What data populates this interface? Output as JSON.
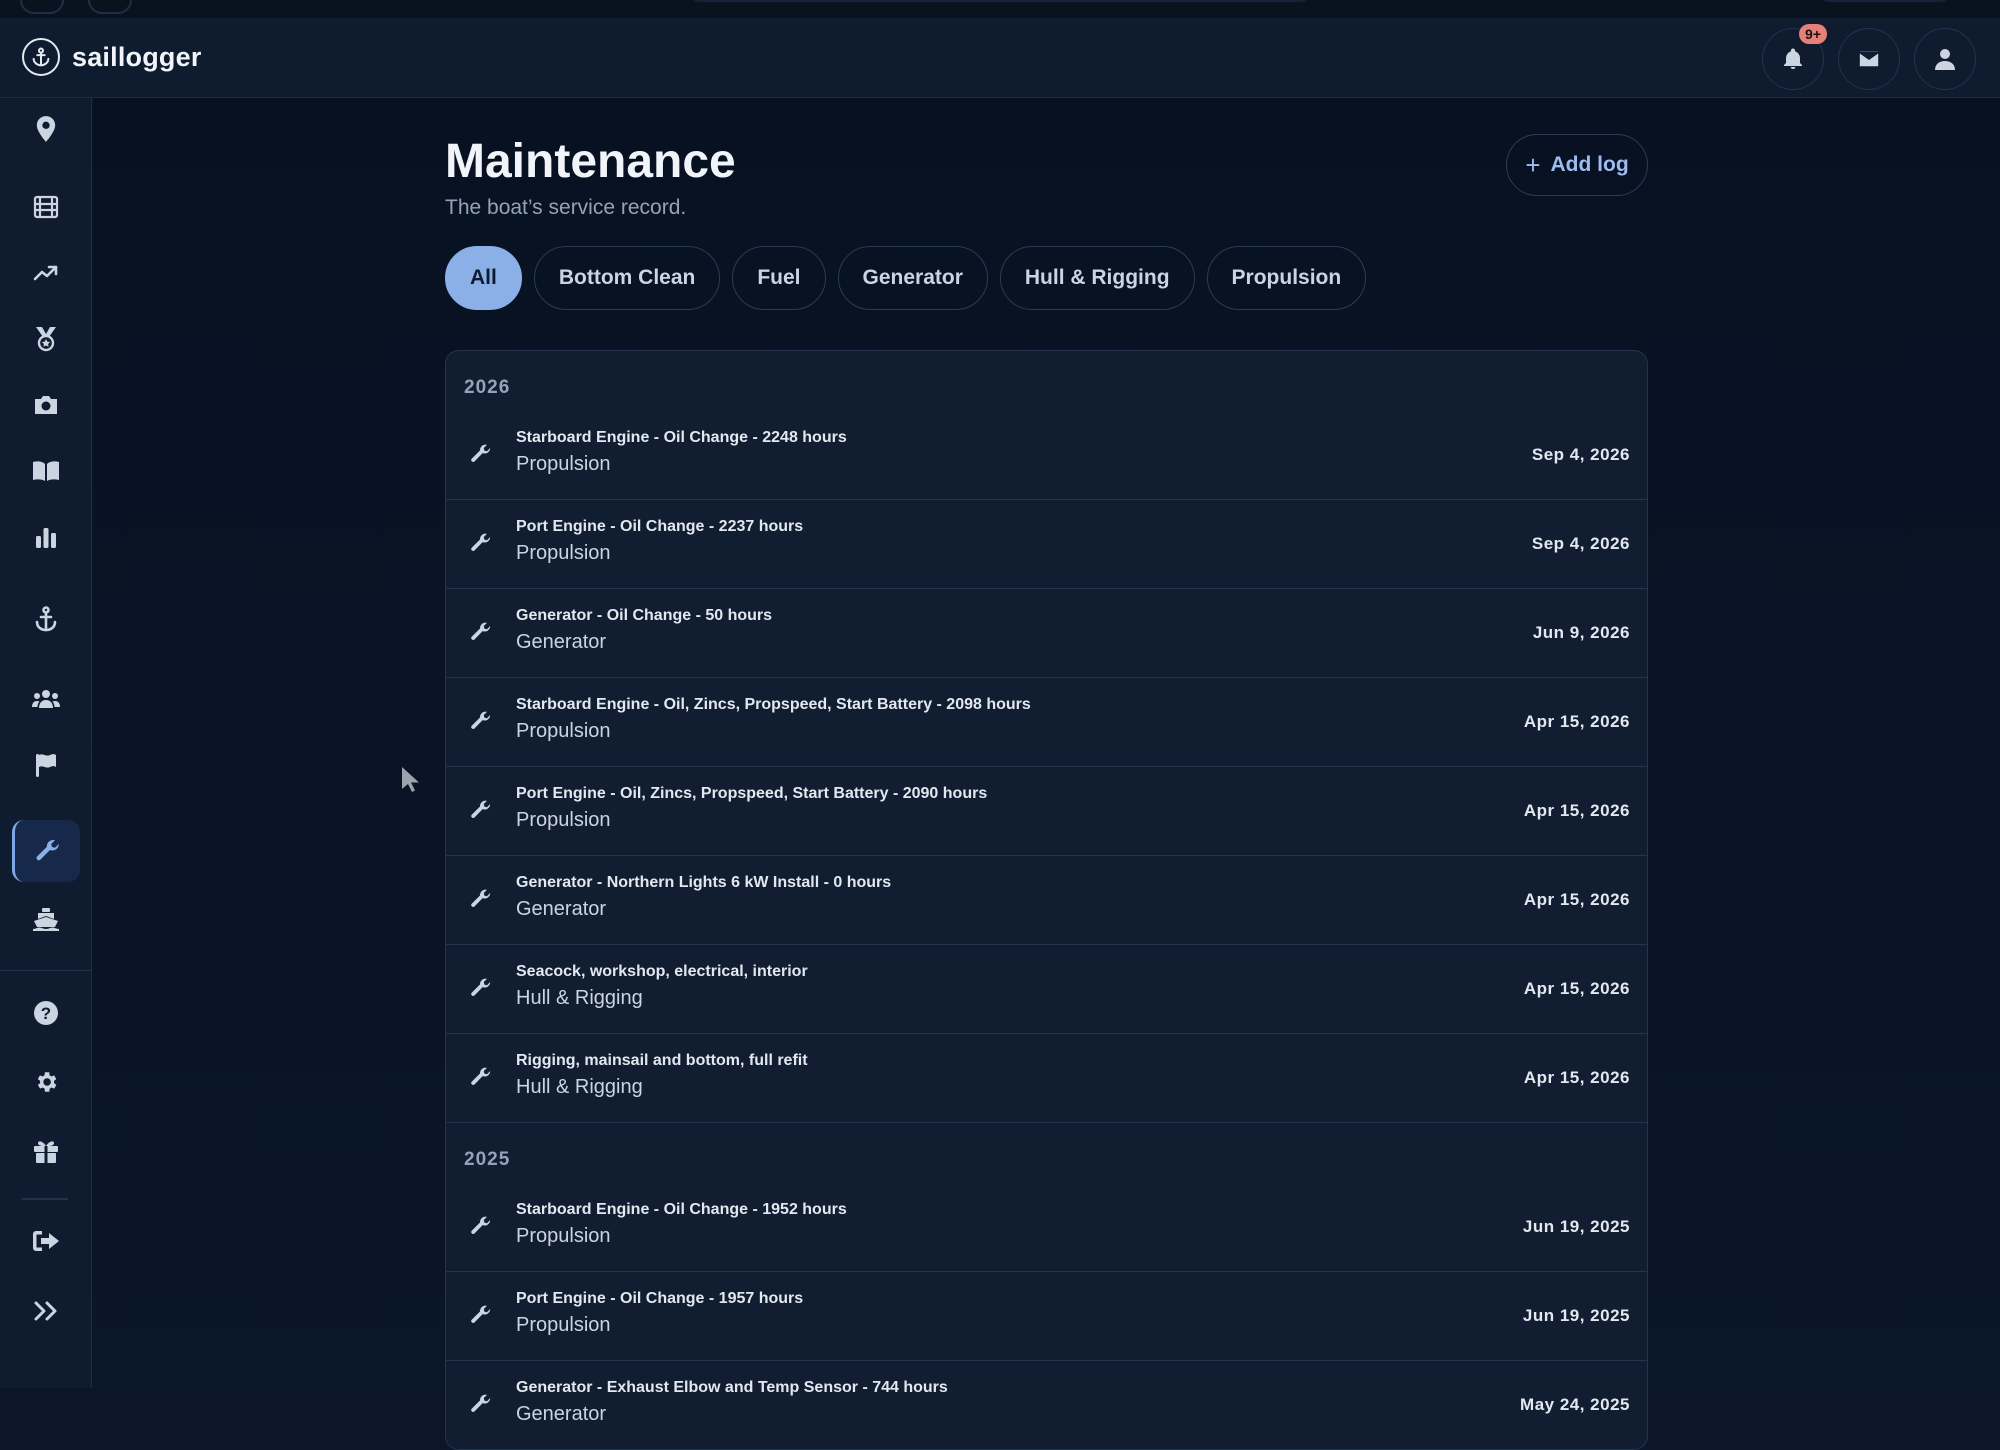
{
  "app": {
    "name": "saillogger",
    "notification_badge": "9+"
  },
  "page": {
    "title": "Maintenance",
    "subtitle": "The boat’s service record.",
    "add_label": "Add log"
  },
  "filters": [
    "All",
    "Bottom Clean",
    "Fuel",
    "Generator",
    "Hull & Rigging",
    "Propulsion"
  ],
  "active_filter": "All",
  "sidebar": {
    "items": [
      "location-pin-icon",
      "film-icon",
      "trending-up-icon",
      "medal-icon",
      "camera-icon",
      "book-icon",
      "bar-chart-icon",
      "anchor-icon",
      "users-icon",
      "flag-icon",
      "wrench-icon",
      "ship-icon"
    ],
    "bottom_items": [
      "help-icon",
      "settings-icon",
      "gift-icon",
      "logout-icon",
      "expand-icon"
    ],
    "active": "wrench-icon"
  },
  "colors": {
    "accent": "#8bb0e8",
    "badge": "#e8807a",
    "background": "#0b1629"
  },
  "groups": [
    {
      "year": "2026",
      "entries": [
        {
          "title": "Starboard Engine - Oil Change - 2248 hours",
          "category": "Propulsion",
          "date": "Sep 4, 2026"
        },
        {
          "title": "Port Engine - Oil Change - 2237 hours",
          "category": "Propulsion",
          "date": "Sep 4, 2026"
        },
        {
          "title": "Generator - Oil Change - 50 hours",
          "category": "Generator",
          "date": "Jun 9, 2026"
        },
        {
          "title": "Starboard Engine - Oil, Zincs, Propspeed, Start Battery - 2098 hours",
          "category": "Propulsion",
          "date": "Apr 15, 2026"
        },
        {
          "title": "Port Engine - Oil, Zincs, Propspeed, Start Battery - 2090 hours",
          "category": "Propulsion",
          "date": "Apr 15, 2026"
        },
        {
          "title": "Generator - Northern Lights 6 kW Install - 0 hours",
          "category": "Generator",
          "date": "Apr 15, 2026"
        },
        {
          "title": "Seacock, workshop, electrical, interior",
          "category": "Hull & Rigging",
          "date": "Apr 15, 2026"
        },
        {
          "title": "Rigging, mainsail and bottom, full refit",
          "category": "Hull & Rigging",
          "date": "Apr 15, 2026"
        }
      ]
    },
    {
      "year": "2025",
      "entries": [
        {
          "title": "Starboard Engine - Oil Change - 1952 hours",
          "category": "Propulsion",
          "date": "Jun 19, 2025"
        },
        {
          "title": "Port Engine - Oil Change - 1957 hours",
          "category": "Propulsion",
          "date": "Jun 19, 2025"
        },
        {
          "title": "Generator - Exhaust Elbow and Temp Sensor - 744 hours",
          "category": "Generator",
          "date": "May 24, 2025"
        }
      ]
    }
  ]
}
